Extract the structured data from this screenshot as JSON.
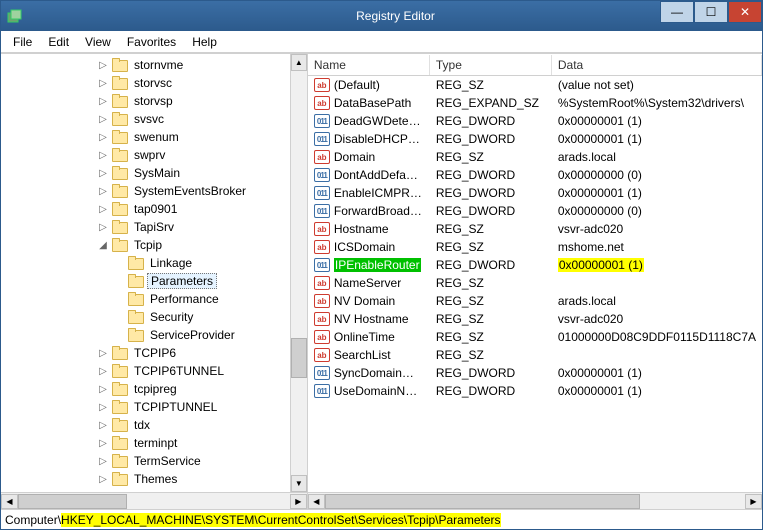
{
  "window": {
    "title": "Registry Editor"
  },
  "menu": {
    "file": "File",
    "edit": "Edit",
    "view": "View",
    "favorites": "Favorites",
    "help": "Help"
  },
  "tree": {
    "items": [
      {
        "indent": 6,
        "exp": "▷",
        "label": "stornvme"
      },
      {
        "indent": 6,
        "exp": "▷",
        "label": "storvsc"
      },
      {
        "indent": 6,
        "exp": "▷",
        "label": "storvsp"
      },
      {
        "indent": 6,
        "exp": "▷",
        "label": "svsvc"
      },
      {
        "indent": 6,
        "exp": "▷",
        "label": "swenum"
      },
      {
        "indent": 6,
        "exp": "▷",
        "label": "swprv"
      },
      {
        "indent": 6,
        "exp": "▷",
        "label": "SysMain"
      },
      {
        "indent": 6,
        "exp": "▷",
        "label": "SystemEventsBroker"
      },
      {
        "indent": 6,
        "exp": "▷",
        "label": "tap0901"
      },
      {
        "indent": 6,
        "exp": "▷",
        "label": "TapiSrv"
      },
      {
        "indent": 6,
        "exp": "◢",
        "label": "Tcpip"
      },
      {
        "indent": 7,
        "exp": "",
        "label": "Linkage"
      },
      {
        "indent": 7,
        "exp": "",
        "label": "Parameters",
        "selected": true
      },
      {
        "indent": 7,
        "exp": "",
        "label": "Performance"
      },
      {
        "indent": 7,
        "exp": "",
        "label": "Security"
      },
      {
        "indent": 7,
        "exp": "",
        "label": "ServiceProvider"
      },
      {
        "indent": 6,
        "exp": "▷",
        "label": "TCPIP6"
      },
      {
        "indent": 6,
        "exp": "▷",
        "label": "TCPIP6TUNNEL"
      },
      {
        "indent": 6,
        "exp": "▷",
        "label": "tcpipreg"
      },
      {
        "indent": 6,
        "exp": "▷",
        "label": "TCPIPTUNNEL"
      },
      {
        "indent": 6,
        "exp": "▷",
        "label": "tdx"
      },
      {
        "indent": 6,
        "exp": "▷",
        "label": "terminpt"
      },
      {
        "indent": 6,
        "exp": "▷",
        "label": "TermService"
      },
      {
        "indent": 6,
        "exp": "▷",
        "label": "Themes"
      }
    ]
  },
  "list": {
    "headers": {
      "name": "Name",
      "type": "Type",
      "data": "Data"
    },
    "rows": [
      {
        "icon": "ab",
        "name": "(Default)",
        "type": "REG_SZ",
        "data": "(value not set)"
      },
      {
        "icon": "ab",
        "name": "DataBasePath",
        "type": "REG_EXPAND_SZ",
        "data": "%SystemRoot%\\System32\\drivers\\"
      },
      {
        "icon": "bin",
        "name": "DeadGWDetect...",
        "type": "REG_DWORD",
        "data": "0x00000001 (1)"
      },
      {
        "icon": "bin",
        "name": "DisableDHCPMe...",
        "type": "REG_DWORD",
        "data": "0x00000001 (1)"
      },
      {
        "icon": "ab",
        "name": "Domain",
        "type": "REG_SZ",
        "data": "arads.local"
      },
      {
        "icon": "bin",
        "name": "DontAddDefault...",
        "type": "REG_DWORD",
        "data": "0x00000000 (0)"
      },
      {
        "icon": "bin",
        "name": "EnableICMPRedi...",
        "type": "REG_DWORD",
        "data": "0x00000001 (1)"
      },
      {
        "icon": "bin",
        "name": "ForwardBroadca...",
        "type": "REG_DWORD",
        "data": "0x00000000 (0)"
      },
      {
        "icon": "ab",
        "name": "Hostname",
        "type": "REG_SZ",
        "data": "vsvr-adc020"
      },
      {
        "icon": "ab",
        "name": "ICSDomain",
        "type": "REG_SZ",
        "data": "mshome.net"
      },
      {
        "icon": "bin",
        "name": "IPEnableRouter",
        "type": "REG_DWORD",
        "data": "0x00000001 (1)",
        "hl": true
      },
      {
        "icon": "ab",
        "name": "NameServer",
        "type": "REG_SZ",
        "data": ""
      },
      {
        "icon": "ab",
        "name": "NV Domain",
        "type": "REG_SZ",
        "data": "arads.local"
      },
      {
        "icon": "ab",
        "name": "NV Hostname",
        "type": "REG_SZ",
        "data": "vsvr-adc020"
      },
      {
        "icon": "ab",
        "name": "OnlineTime",
        "type": "REG_SZ",
        "data": "01000000D08C9DDF0115D1118C7A"
      },
      {
        "icon": "ab",
        "name": "SearchList",
        "type": "REG_SZ",
        "data": ""
      },
      {
        "icon": "bin",
        "name": "SyncDomainWit...",
        "type": "REG_DWORD",
        "data": "0x00000001 (1)"
      },
      {
        "icon": "bin",
        "name": "UseDomainNam...",
        "type": "REG_DWORD",
        "data": "0x00000001 (1)"
      }
    ]
  },
  "status": {
    "prefix": "Computer\\",
    "path": "HKEY_LOCAL_MACHINE\\SYSTEM\\CurrentControlSet\\Services\\Tcpip\\Parameters"
  }
}
